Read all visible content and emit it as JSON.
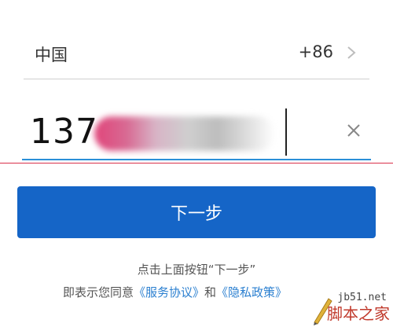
{
  "country": {
    "name": "中国",
    "code": "+86"
  },
  "phone": {
    "prefix": "137"
  },
  "next_button": {
    "label": "下一步"
  },
  "agreement": {
    "line1": "点击上面按钮“下一步”",
    "line2_prefix": "即表示您同意",
    "service_link": "《服务协议》",
    "conjunction": "和",
    "privacy_link": "《隐私政策》"
  },
  "watermark": {
    "site": "jb51.net",
    "name": "脚本之家"
  }
}
